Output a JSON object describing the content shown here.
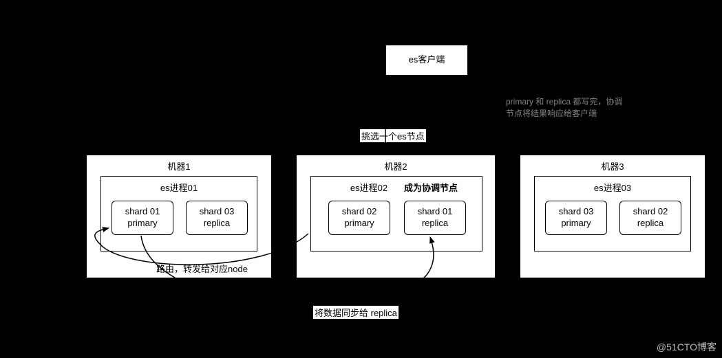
{
  "client": {
    "label": "es客户端"
  },
  "annotations": {
    "selectNode": "挑选一个es节点",
    "respond_line1": "primary 和 replica 都写完，协调",
    "respond_line2": "节点将结果响应给客户端",
    "route": "路由，转发给对应node",
    "sync": "将数据同步给 replica",
    "coordinator": "成为协调节点"
  },
  "machines": [
    {
      "title": "机器1",
      "process": "es进程01",
      "shards": [
        {
          "l1": "shard 01",
          "l2": "primary"
        },
        {
          "l1": "shard 03",
          "l2": "replica"
        }
      ]
    },
    {
      "title": "机器2",
      "process": "es进程02",
      "shards": [
        {
          "l1": "shard 02",
          "l2": "primary"
        },
        {
          "l1": "shard 01",
          "l2": "replica"
        }
      ]
    },
    {
      "title": "机器3",
      "process": "es进程03",
      "shards": [
        {
          "l1": "shard 03",
          "l2": "primary"
        },
        {
          "l1": "shard 02",
          "l2": "replica"
        }
      ]
    }
  ],
  "watermark": "@51CTO博客"
}
